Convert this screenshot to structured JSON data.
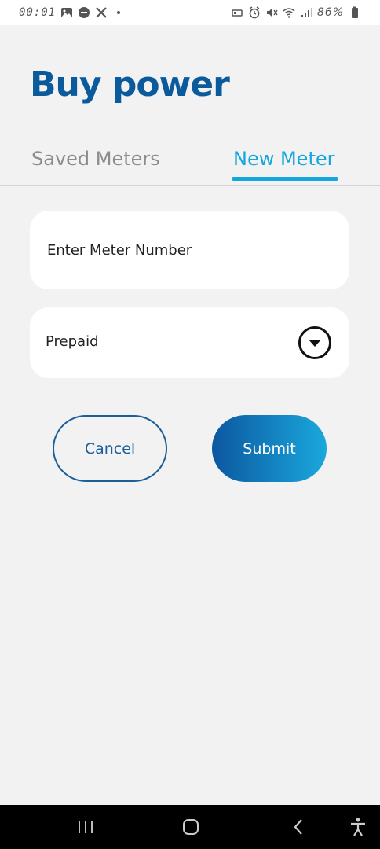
{
  "status_bar": {
    "time": "00:01",
    "battery": "86%",
    "left_icons": [
      "gallery-icon",
      "do-not-disturb-icon",
      "x-logo-icon",
      "dot-icon"
    ],
    "right_icons": [
      "screen-record-icon",
      "alarm-icon",
      "mute-icon",
      "wifi-icon",
      "signal-icon",
      "battery-icon"
    ]
  },
  "page": {
    "title": "Buy power"
  },
  "tabs": [
    {
      "label": "Saved Meters",
      "active": false
    },
    {
      "label": "New Meter",
      "active": true
    }
  ],
  "form": {
    "meter_number_placeholder": "Enter Meter Number",
    "meter_number_value": "",
    "meter_type_selected": "Prepaid"
  },
  "buttons": {
    "cancel_label": "Cancel",
    "submit_label": "Submit"
  },
  "colors": {
    "title": "#0a5a9c",
    "accent": "#14a6dc",
    "cancel_border": "#1b5e9a",
    "submit_gradient_start": "#0c57a0",
    "submit_gradient_end": "#1aa8dc",
    "background": "#f2f2f2"
  },
  "nav_bar": {
    "icons": [
      "recents-icon",
      "home-icon",
      "back-icon",
      "accessibility-icon"
    ]
  }
}
